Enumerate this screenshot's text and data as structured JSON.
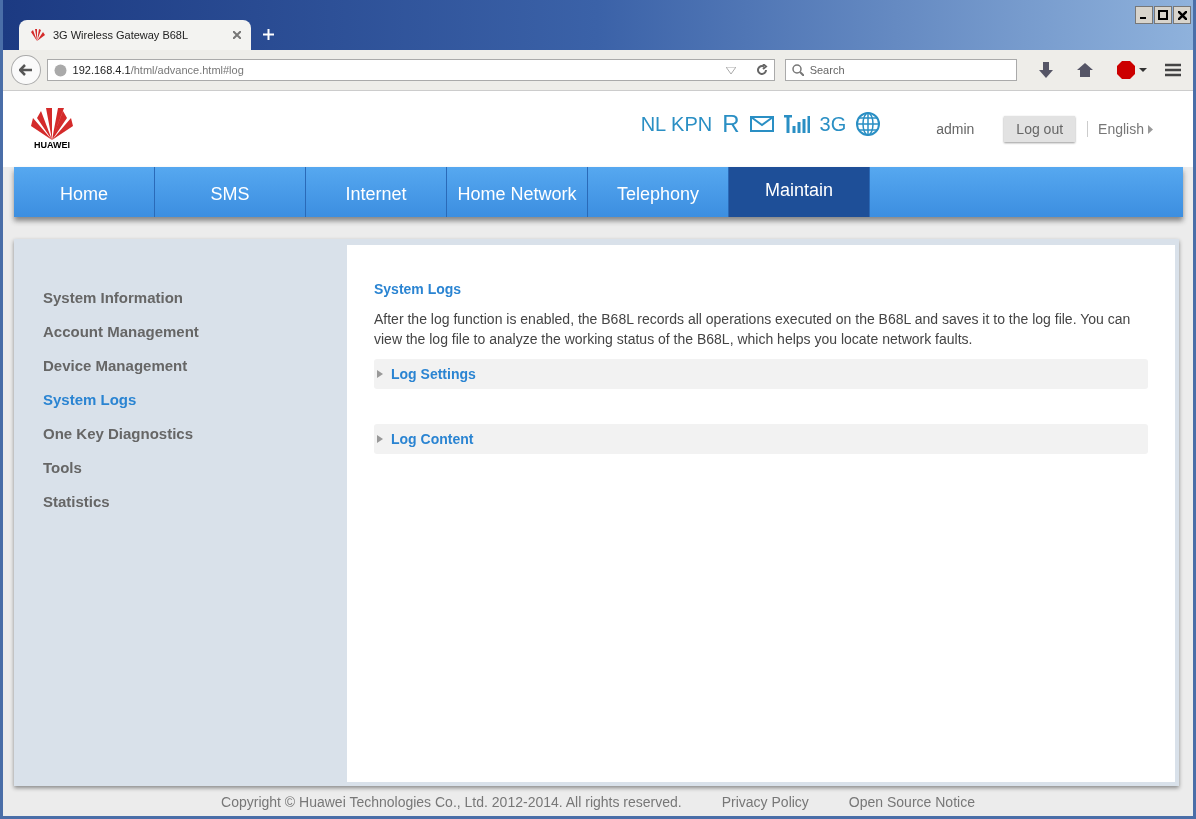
{
  "browser": {
    "tab_title": "3G Wireless Gateway B68L",
    "url_host": "192.168.4.1",
    "url_path": "/html/advance.html#log",
    "search_placeholder": "Search"
  },
  "logo": "HUAWEI",
  "status": {
    "operator": "NL KPN",
    "roaming": "R",
    "network": "3G"
  },
  "user": "admin",
  "logout": "Log out",
  "language": "English",
  "nav": [
    {
      "label": "Home",
      "selected": false
    },
    {
      "label": "SMS",
      "selected": false
    },
    {
      "label": "Internet",
      "selected": false
    },
    {
      "label": "Home Network",
      "selected": false
    },
    {
      "label": "Telephony",
      "selected": false
    },
    {
      "label": "Maintain",
      "selected": true
    }
  ],
  "sidebar": [
    {
      "label": "System Information",
      "selected": false
    },
    {
      "label": "Account Management",
      "selected": false
    },
    {
      "label": "Device Management",
      "selected": false
    },
    {
      "label": "System Logs",
      "selected": true
    },
    {
      "label": "One Key Diagnostics",
      "selected": false
    },
    {
      "label": "Tools",
      "selected": false
    },
    {
      "label": "Statistics",
      "selected": false
    }
  ],
  "section": {
    "title": "System Logs",
    "description": "After the log function is enabled, the B68L records all operations executed on the B68L and saves it to the log file. You can view the log file to analyze the working status of the B68L, which helps you locate network faults.",
    "panels": [
      {
        "label": "Log Settings",
        "expanded": false
      },
      {
        "label": "Log Content",
        "expanded": false
      }
    ]
  },
  "footer": {
    "copyright": "Copyright © Huawei Technologies Co., Ltd. 2012-2014. All rights reserved.",
    "links": [
      "Privacy Policy",
      "Open Source Notice"
    ]
  }
}
